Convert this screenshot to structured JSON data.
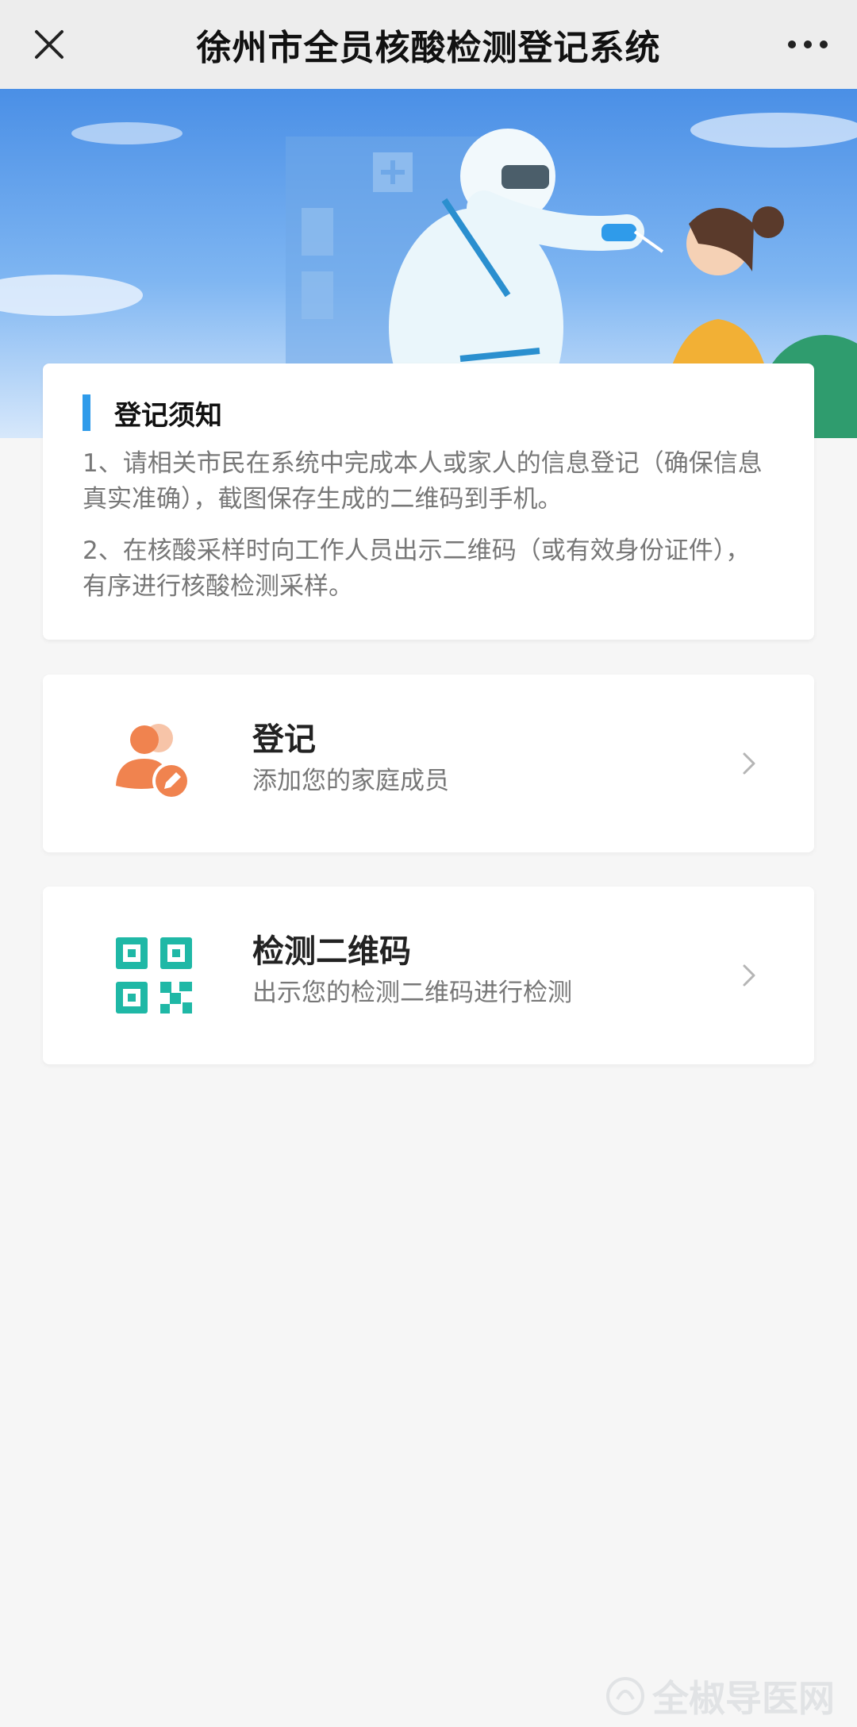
{
  "header": {
    "title": "徐州市全员核酸检测登记系统",
    "close_icon": "close-icon",
    "more_icon": "more-icon"
  },
  "notice": {
    "title": "登记须知",
    "items": [
      "1、请相关市民在系统中完成本人或家人的信息登记（确保信息真实准确），截图保存生成的二维码到手机。",
      "2、在核酸采样时向工作人员出示二维码（或有效身份证件），有序进行核酸检测采样。"
    ]
  },
  "actions": [
    {
      "title": "登记",
      "subtitle": "添加您的家庭成员",
      "icon": "user-edit-icon"
    },
    {
      "title": "检测二维码",
      "subtitle": "出示您的检测二维码进行检测",
      "icon": "qr-code-icon"
    }
  ],
  "watermark": {
    "text": "全椒导医网"
  },
  "colors": {
    "accent_blue": "#2f9bea",
    "orange": "#f0834f",
    "teal": "#1fb8a6"
  }
}
